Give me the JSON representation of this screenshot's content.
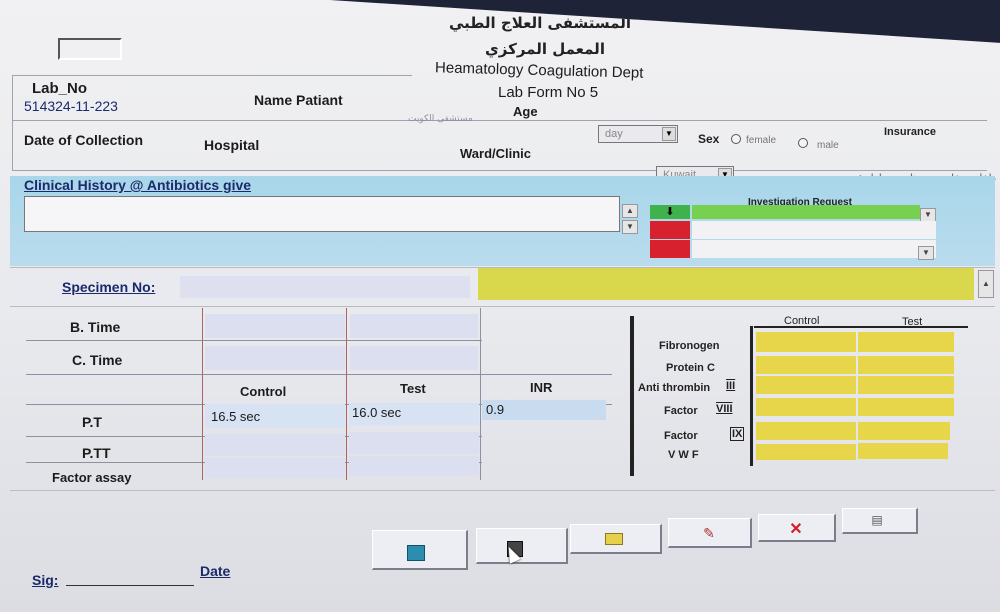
{
  "header": {
    "arabic_line1": "المستشفى العلاج الطبي",
    "arabic_line2": "المعمل المركزي",
    "dept": "Heamatology Coagulation Dept",
    "form": "Lab Form No 5"
  },
  "patient": {
    "lab_no_label": "Lab_No",
    "lab_no_value": "514324-11-223",
    "name_label": "Name Patiant",
    "age_label": "Age",
    "age_unit": "day",
    "sex_label": "Sex",
    "sex_female": "female",
    "sex_male": "male",
    "insurance_label": "Insurance",
    "date_label": "Date of Collection",
    "hospital_label": "Hospital",
    "ward_label": "Ward/Clinic",
    "ward_value": "Kuwait",
    "arabic_hint": "مستشفى الكويت",
    "patient_types": [
      "داخلي",
      "خارجي",
      "متابعة",
      "طوارئ"
    ]
  },
  "clinical": {
    "label": "Clinical History @ Antibiotics give",
    "investigation_label": "Investigation Request"
  },
  "specimen": {
    "label": "Specimen No:"
  },
  "coag_table": {
    "b_time": "B. Time",
    "c_time": "C. Time",
    "headers": [
      "Control",
      "Test",
      "INR"
    ],
    "rows": [
      {
        "label": "P.T",
        "control": "16.5 sec",
        "test": "16.0 sec",
        "inr": "0.9"
      },
      {
        "label": "P.TT",
        "control": "",
        "test": "",
        "inr": ""
      },
      {
        "label": "Factor assay",
        "control": "",
        "test": "",
        "inr": ""
      }
    ]
  },
  "factors": {
    "headers": [
      "Control",
      "Test"
    ],
    "items": [
      "Fibronogen",
      "Protein C",
      "Anti thrombin",
      "Factor",
      "Factor",
      "V W F"
    ],
    "roman": [
      "III",
      "VIII",
      "IX"
    ]
  },
  "footer": {
    "sig_label": "Sig:",
    "date_label": "Date"
  },
  "toolbar": {
    "buttons": [
      "exit-icon",
      "save-icon",
      "open-folder-icon",
      "edit-icon",
      "delete-icon",
      "print-icon"
    ]
  }
}
